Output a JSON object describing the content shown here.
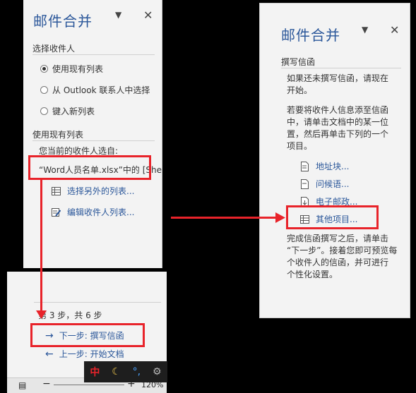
{
  "left": {
    "title": "邮件合并",
    "section1": "选择收件人",
    "options": [
      "使用现有列表",
      "从 Outlook 联系人中选择",
      "键入新列表"
    ],
    "section2": "使用现有列表",
    "current_label": "您当前的收件人选自:",
    "current_source": "“Word人员名单.xlsx”中的 [She",
    "links": [
      "选择另外的列表...",
      "编辑收件人列表..."
    ]
  },
  "steps": {
    "step_label": "第 3 步，共 6 步",
    "next": "下一步: 撰写信函",
    "prev": "上一步: 开始文档",
    "zoom": "120%"
  },
  "ime": {
    "lang": "中",
    "punct": "°,"
  },
  "right": {
    "title": "邮件合并",
    "section": "撰写信函",
    "para1": [
      "如果还未撰写信函，请现在",
      "开始。"
    ],
    "para2": [
      "若要将收件人信息添至信函",
      "中，请单击文档中的某一位",
      "置，然后再单击下列的一个",
      "项目。"
    ],
    "links": [
      "地址块...",
      "问候语...",
      "电子邮政...",
      "其他项目..."
    ],
    "para3": [
      "完成信函撰写之后，请单击",
      "“下一步”。接着您即可预览每",
      "个收件人的信函，并可进行",
      "个性化设置。"
    ]
  },
  "colors": {
    "accent": "#2b579a",
    "highlight": "#e8232a",
    "pane": "#f3f3f3"
  }
}
